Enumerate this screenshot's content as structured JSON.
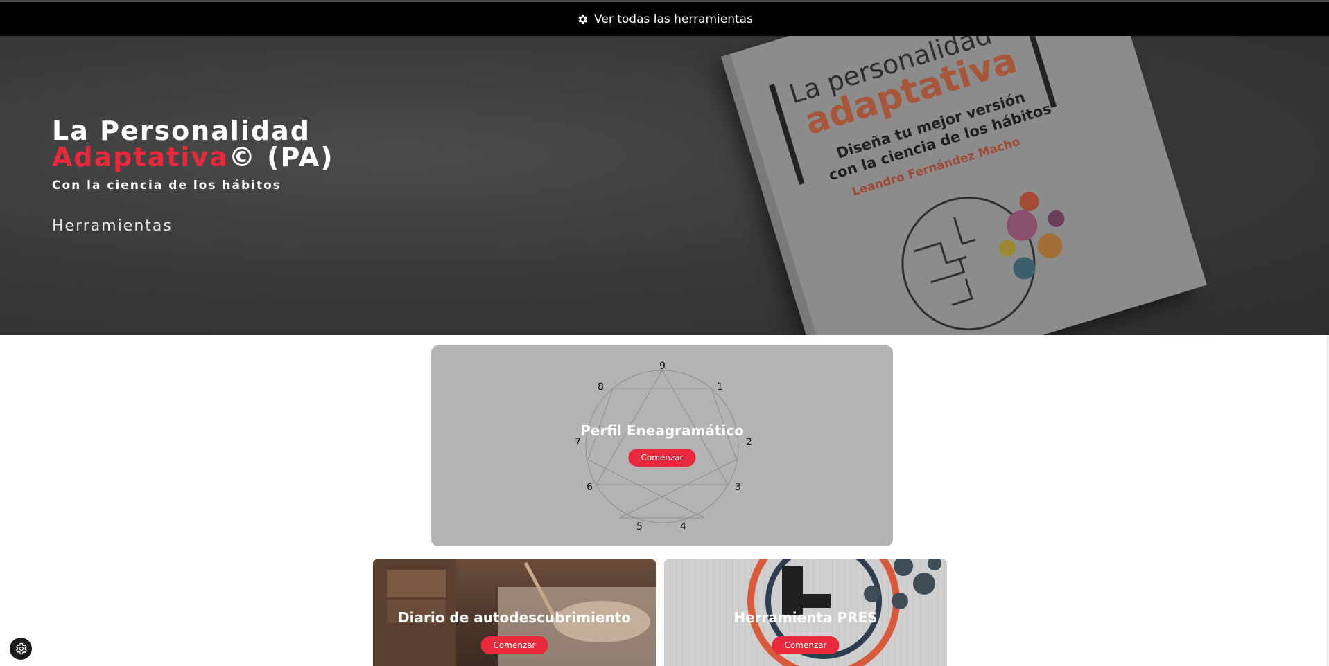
{
  "topbar": {
    "link_label": "Ver todas las herramientas",
    "icon": "gear-icon"
  },
  "hero": {
    "title_line1": "La Personalidad",
    "title_accent": "Adaptativa",
    "title_suffix": "© (PA)",
    "subtitle": "Con la ciencia de los hábitos",
    "tools_link": "Herramientas"
  },
  "book": {
    "title_small": "La personalidad",
    "title_big": "adaptativa",
    "subtitle_line1": "Diseña tu mejor versión",
    "subtitle_line2": "con la ciencia de los hábitos",
    "author": "Leandro Fernández Macho"
  },
  "tools": {
    "enneagram": {
      "title": "Perfil Eneagramático",
      "button": "Comenzar",
      "numbers": [
        "9",
        "1",
        "2",
        "3",
        "4",
        "5",
        "6",
        "7",
        "8"
      ]
    },
    "diary": {
      "title": "Diario de autodescubrimiento",
      "button": "Comenzar"
    },
    "pres": {
      "title": "Herramienta PRES",
      "button": "Comenzar"
    }
  },
  "colors": {
    "accent": "#e8293b",
    "topbar": "#000000",
    "card_gray": "#b3b3b3"
  }
}
